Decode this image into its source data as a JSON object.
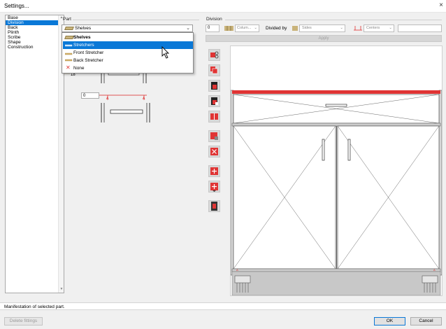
{
  "window": {
    "title": "Settings...",
    "close_glyph": "×"
  },
  "left_list": {
    "items": [
      {
        "label": "Base"
      },
      {
        "label": "Division"
      },
      {
        "label": "Back"
      },
      {
        "label": "Plinth"
      },
      {
        "label": "Scribe"
      },
      {
        "label": "Shape"
      },
      {
        "label": "Construction"
      }
    ],
    "selected_index": 1
  },
  "part": {
    "label": "Part",
    "selected": "Shelves",
    "options": [
      {
        "label": "Shelves",
        "icon": "shelf-icon"
      },
      {
        "label": "Stretchers",
        "icon": "stretcher-icon"
      },
      {
        "label": "Front Stretcher",
        "icon": "front-stretcher-icon"
      },
      {
        "label": "Back Stretcher",
        "icon": "back-stretcher-icon"
      },
      {
        "label": "None",
        "icon": "none-x-icon"
      }
    ],
    "highlighted_index": 1
  },
  "preview": {
    "value_partial": "18",
    "offset_value": "0"
  },
  "division": {
    "label": "Division",
    "count_value": "0",
    "columns_label": "Colum...",
    "divided_by_label": "Divided by",
    "sides_label": "Sides",
    "centers_label": "Centers",
    "apply_label": "Apply",
    "accent_red": "#e03434"
  },
  "status": {
    "text": "Manifestation of selected part."
  },
  "buttons": {
    "delete_fittings": "Delete fittings",
    "ok": "OK",
    "cancel": "Cancel"
  }
}
